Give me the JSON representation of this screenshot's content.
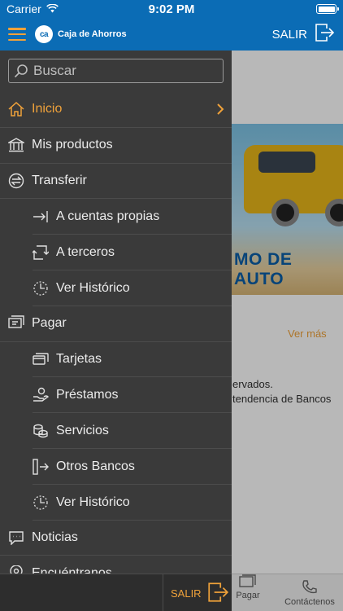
{
  "status_bar": {
    "carrier": "Carrier",
    "time": "9:02 PM"
  },
  "header": {
    "brand": "Caja de Ahorros",
    "logo_mark": "ca",
    "exit_label": "SALIR"
  },
  "search": {
    "placeholder": "Buscar"
  },
  "menu": {
    "items": [
      {
        "label": "Inicio",
        "icon": "home-icon"
      },
      {
        "label": "Mis productos",
        "icon": "bank-icon"
      },
      {
        "label": "Transferir",
        "icon": "transfer-icon"
      },
      {
        "label": "A cuentas propias",
        "icon": "arrow-right-icon"
      },
      {
        "label": "A terceros",
        "icon": "arrow-corner-icon"
      },
      {
        "label": "Ver Histórico",
        "icon": "history-icon"
      },
      {
        "label": "Pagar",
        "icon": "pay-icon"
      },
      {
        "label": "Tarjetas",
        "icon": "cards-icon"
      },
      {
        "label": "Préstamos",
        "icon": "loan-icon"
      },
      {
        "label": "Servicios",
        "icon": "services-icon"
      },
      {
        "label": "Otros Bancos",
        "icon": "other-banks-icon"
      },
      {
        "label": "Ver Histórico",
        "icon": "history-icon"
      },
      {
        "label": "Noticias",
        "icon": "news-icon"
      },
      {
        "label": "Encuéntranos",
        "icon": "location-icon"
      }
    ]
  },
  "drawer_footer": {
    "exit_label": "SALIR"
  },
  "background": {
    "banner_text": "MO DE AUTO",
    "ver_mas": "Ver más",
    "notice_line1": "ervados.",
    "notice_line2": "tendencia de Bancos"
  },
  "tabbar": {
    "pagar_label": "Pagar",
    "contact_label": "Contáctenos"
  },
  "colors": {
    "brand_blue": "#0b6cb5",
    "accent_orange": "#f0a23a",
    "drawer_bg": "#3a3a3a"
  }
}
